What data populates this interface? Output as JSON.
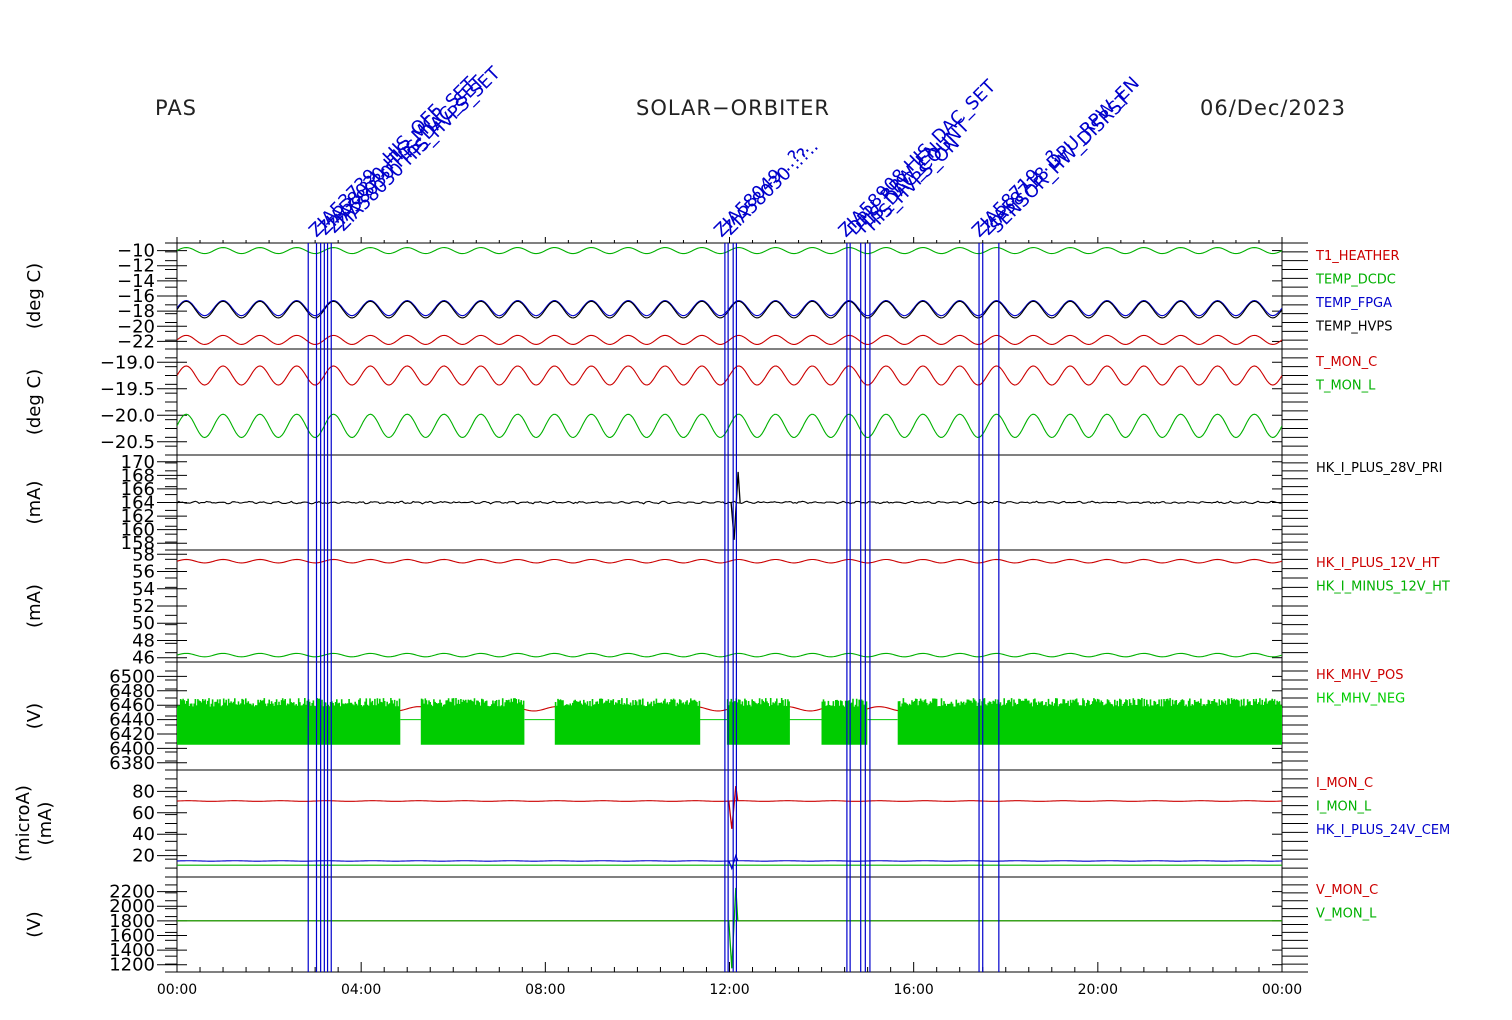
{
  "header": {
    "left": "PAS",
    "center": "SOLAR−ORBITER",
    "right": "06/Dec/2023"
  },
  "colors": {
    "red": "#cc0000",
    "green": "#00b000",
    "bright_green": "#00cc00",
    "blue": "#0000cc",
    "black": "#000000",
    "event_blue": "#0000cc"
  },
  "chart_data": {
    "type": "line",
    "x_axis": {
      "range_hours": [
        0,
        24
      ],
      "tick_labels": [
        "00:00",
        "04:00",
        "08:00",
        "12:00",
        "16:00",
        "20:00",
        "00:00"
      ]
    },
    "events": {
      "times_hours": [
        2.85,
        3.03,
        3.12,
        3.2,
        3.27,
        3.35,
        11.9,
        11.97,
        12.08,
        12.15,
        14.55,
        14.62,
        14.85,
        14.95,
        15.05,
        17.42,
        17.5,
        17.85
      ],
      "label_groups": [
        {
          "at_hours": 3.2,
          "labels": [
            "ZIA53739 ..HIS_OFF",
            "ZIA58030 HIS_MCP_SET",
            "ZIA58030 HIS_DAC_SET",
            "ZIA58030 HIS_HVPS_SET"
          ]
        },
        {
          "at_hours": 12.0,
          "labels": [
            "ZIA58049 ..?..",
            "ZIA58030 ..?.."
          ]
        },
        {
          "at_hours": 14.7,
          "labels": [
            "ZIA58908 HIS_DAC_SET",
            "DPU_RPW_EN",
            "HIS_DAC_COUNT",
            "HIS_HVPS_ON"
          ]
        },
        {
          "at_hours": 17.6,
          "labels": [
            "ZIA58719 ..?..",
            "ZIA58718 DPU_RPW_EN",
            "SENSOR_HW_DISRST"
          ]
        }
      ]
    },
    "panels": [
      {
        "ylabel": "(deg C)",
        "ylim": [
          -23,
          -9
        ],
        "ticks": [
          -10,
          -12,
          -14,
          -16,
          -18,
          -20,
          -22
        ],
        "tick_labels": [
          "−10",
          "−12",
          "−14",
          "−16",
          "−18",
          "−20",
          "−22"
        ],
        "series": [
          {
            "name": "T1_HEATHER",
            "color": "#cc0000",
            "base": -21.8,
            "amp": 0.6,
            "period_hours": 0.8
          },
          {
            "name": "TEMP_DCDC",
            "color": "#00b000",
            "base": -10.0,
            "amp": 0.4,
            "period_hours": 0.8
          },
          {
            "name": "TEMP_FPGA",
            "color": "#0000cc",
            "base": -17.6,
            "amp": 1.0,
            "period_hours": 0.8
          },
          {
            "name": "TEMP_HVPS",
            "color": "#000000",
            "base": -17.8,
            "amp": 1.1,
            "period_hours": 0.8
          }
        ]
      },
      {
        "ylabel": "(deg C)",
        "ylim": [
          -20.75,
          -18.75
        ],
        "ticks": [
          -19.0,
          -19.5,
          -20.0,
          -20.5
        ],
        "tick_labels": [
          "−19.0",
          "−19.5",
          "−20.0",
          "−20.5"
        ],
        "series": [
          {
            "name": "T_MON_C",
            "color": "#cc0000",
            "base": -19.25,
            "amp": 0.18,
            "period_hours": 0.8
          },
          {
            "name": "T_MON_L",
            "color": "#00b000",
            "base": -20.2,
            "amp": 0.22,
            "period_hours": 0.8
          }
        ]
      },
      {
        "ylabel": "(mA)",
        "ylim": [
          157,
          171
        ],
        "ticks": [
          170,
          168,
          166,
          164,
          162,
          160,
          158
        ],
        "tick_labels": [
          "170",
          "168",
          "166",
          "164",
          "162",
          "160",
          "158"
        ],
        "series": [
          {
            "name": "HK_I_PLUS_28V_PRI",
            "color": "#000000",
            "base": 164.0,
            "amp": 0.1,
            "period_hours": 0.3,
            "spike_at_hours": 12.1,
            "spike_min": 158.5,
            "spike_max": 168.5
          }
        ]
      },
      {
        "ylabel": "(mA)",
        "ylim": [
          45.5,
          58.5
        ],
        "ticks": [
          58,
          56,
          54,
          52,
          50,
          48,
          46
        ],
        "tick_labels": [
          "58",
          "56",
          "54",
          "52",
          "50",
          "48",
          "46"
        ],
        "series": [
          {
            "name": "HK_I_PLUS_12V_HT",
            "color": "#cc0000",
            "base": 57.2,
            "amp": 0.2,
            "period_hours": 0.8
          },
          {
            "name": "HK_I_MINUS_12V_HT",
            "color": "#00b000",
            "base": 46.3,
            "amp": 0.2,
            "period_hours": 0.8
          }
        ]
      },
      {
        "ylabel": "(V)",
        "ylim": [
          6370,
          6520
        ],
        "ticks": [
          6500,
          6480,
          6460,
          6440,
          6420,
          6400,
          6380
        ],
        "tick_labels": [
          "6500",
          "6480",
          "6460",
          "6440",
          "6420",
          "6400",
          "6380"
        ],
        "series": [
          {
            "name": "HK_MHV_POS",
            "color": "#cc0000",
            "base": 6455,
            "amp": 3
          },
          {
            "name": "HK_MHV_NEG",
            "color": "#00cc00",
            "band_low": 6405,
            "band_high": 6470,
            "gaps_hours": [
              [
                4.85,
                5.3
              ],
              [
                7.55,
                8.2
              ],
              [
                11.35,
                11.95
              ],
              [
                13.3,
                14.0
              ],
              [
                15.0,
                15.65
              ]
            ]
          }
        ]
      },
      {
        "ylabel": "(microA)\n(mA)",
        "ylim": [
          0,
          100
        ],
        "ticks": [
          80,
          60,
          40,
          20
        ],
        "tick_labels": [
          "80",
          "60",
          "40",
          "20"
        ],
        "series": [
          {
            "name": "I_MON_C",
            "color": "#cc0000",
            "base": 71,
            "amp": 0.3,
            "spike_at_hours": 12.05,
            "spike_min": 45,
            "spike_max": 85
          },
          {
            "name": "I_MON_L",
            "color": "#00b000",
            "base": 11,
            "amp": 0
          },
          {
            "name": "HK_I_PLUS_24V_CEM",
            "color": "#0000cc",
            "base": 15,
            "amp": 0.2,
            "spike_at_hours": 12.05,
            "spike_min": 8,
            "spike_max": 20
          }
        ]
      },
      {
        "ylabel": "(V)",
        "ylim": [
          1100,
          2400
        ],
        "ticks": [
          2200,
          2000,
          1800,
          1600,
          1400,
          1200
        ],
        "tick_labels": [
          "2200",
          "2000",
          "1800",
          "1600",
          "1400",
          "1200"
        ],
        "series": [
          {
            "name": "V_MON_C",
            "color": "#cc0000",
            "base": 1800,
            "amp": 0
          },
          {
            "name": "V_MON_L",
            "color": "#00b000",
            "base": 1800,
            "amp": 0,
            "spike_at_hours": 12.05,
            "spike_min": 1150,
            "spike_max": 2250
          }
        ]
      }
    ]
  }
}
